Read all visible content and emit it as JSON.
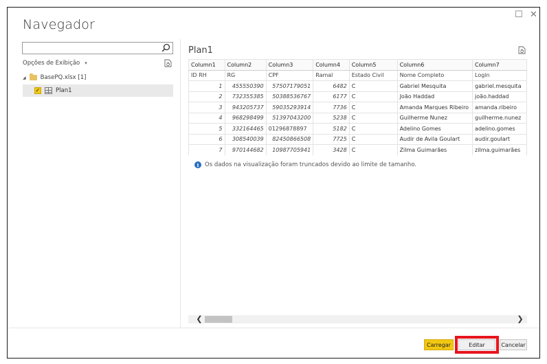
{
  "window": {
    "title": "Navegador",
    "maximize_glyph": "☐",
    "close_glyph": "✕"
  },
  "left_panel": {
    "search": {
      "value": "",
      "placeholder": ""
    },
    "display_options_label": "Opções de Exibição",
    "display_options_caret": "▾",
    "tree": {
      "file": {
        "toggle": "◢",
        "label": "BasePQ.xlsx [1]"
      },
      "sheet": {
        "label": "Plan1",
        "checked": true,
        "check_glyph": "✓"
      }
    }
  },
  "preview": {
    "title": "Plan1",
    "columns": [
      "Column1",
      "Column2",
      "Column3",
      "Column4",
      "Column5",
      "Column6",
      "Column7"
    ],
    "rows": [
      [
        "ID RH",
        "RG",
        "CPF",
        "Ramal",
        "Estado Civil",
        "Nome Completo",
        "Login"
      ],
      [
        "1",
        "455550390",
        "57507179051",
        "6482",
        "C",
        "Gabriel Mesquita",
        "gabriel.mesquita"
      ],
      [
        "2",
        "732355385",
        "50388536767",
        "6177",
        "C",
        "João Haddad",
        "joão.haddad"
      ],
      [
        "3",
        "943205737",
        "59035293914",
        "7736",
        "C",
        "Amanda Marques Ribeiro",
        "amanda.ribeiro"
      ],
      [
        "4",
        "968298499",
        "51397043200",
        "5238",
        "C",
        "Guilherme Nunez",
        "guilherme.nunez"
      ],
      [
        "5",
        "332164465",
        "01296878897",
        "5182",
        "C",
        "Adelino Gomes",
        "adelino.gomes"
      ],
      [
        "6",
        "308540039",
        "82450866508",
        "7725",
        "C",
        "Audir de Avila Goulart",
        "audir.goulart"
      ],
      [
        "7",
        "970144682",
        "10987705941",
        "3428",
        "C",
        "Zilma Guimarães",
        "zilma.guimarães"
      ]
    ],
    "notice": "Os dados na visualização foram truncados devido ao limite de tamanho.",
    "info_glyph": "i",
    "scroll_left": "❮",
    "scroll_right": "❯"
  },
  "footer": {
    "load_label": "Carregar",
    "edit_label": "Editar",
    "cancel_label": "Cancelar"
  },
  "colors": {
    "accent_yellow": "#f2c811",
    "highlight_red": "#e8141d",
    "info_blue": "#2a6ebd"
  }
}
